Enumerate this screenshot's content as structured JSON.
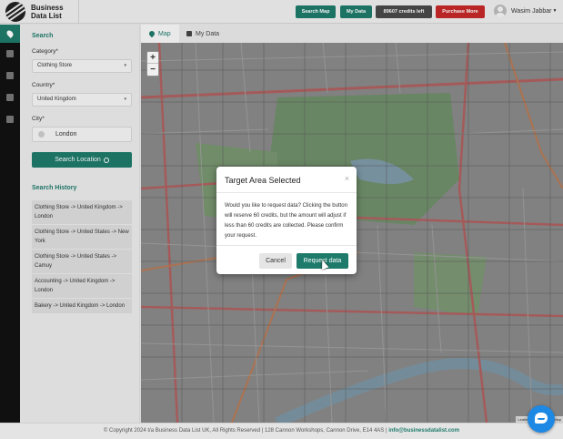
{
  "brand": {
    "name_line1": "Business",
    "name_line2": "Data List"
  },
  "topbar": {
    "search_map": "Search Map",
    "my_data": "My Data",
    "credits": "89607 credits left",
    "purchase": "Purchase More",
    "user": "Wasim Jabbar"
  },
  "rail": {
    "icons": [
      "map-marker-icon",
      "database-icon",
      "card-icon",
      "user-icon",
      "envelope-icon"
    ]
  },
  "search": {
    "title": "Search",
    "category_label": "Category*",
    "category_value": "Clothing Store",
    "country_label": "Country*",
    "country_value": "United Kingdom",
    "city_label": "City*",
    "city_value": "London",
    "button": "Search Location"
  },
  "history": {
    "title": "Search History",
    "items": [
      "Clothing Store -> United Kingdom -> London",
      "Clothing Store -> United States -> New York",
      "Clothing Store -> United States -> Camuy",
      "Accounting -> United Kingdom -> London",
      "Bakery -> United Kingdom -> London"
    ]
  },
  "tabs": {
    "map": "Map",
    "my_data": "My Data"
  },
  "map": {
    "zoom_in": "+",
    "zoom_out": "−",
    "attribution": "Leaflet | © OpenStreetMap"
  },
  "modal": {
    "title": "Target Area Selected",
    "close": "×",
    "body": "Would you like to request data? Clicking the button will reserve 60 credits, but the amount will adjust if less than 60 credits are collected. Please confirm your request.",
    "cancel": "Cancel",
    "request": "Request data"
  },
  "footer": {
    "text": "© Copyright 2024 t/a Business Data List UK, All Rights Reserved | 128 Cannon Workshops, Cannon Drive, E14 4AS |",
    "email": "info@businessdatalist.com"
  },
  "colors": {
    "accent": "#1e7b6b",
    "danger": "#c62828",
    "dark": "#4a4a4a"
  }
}
